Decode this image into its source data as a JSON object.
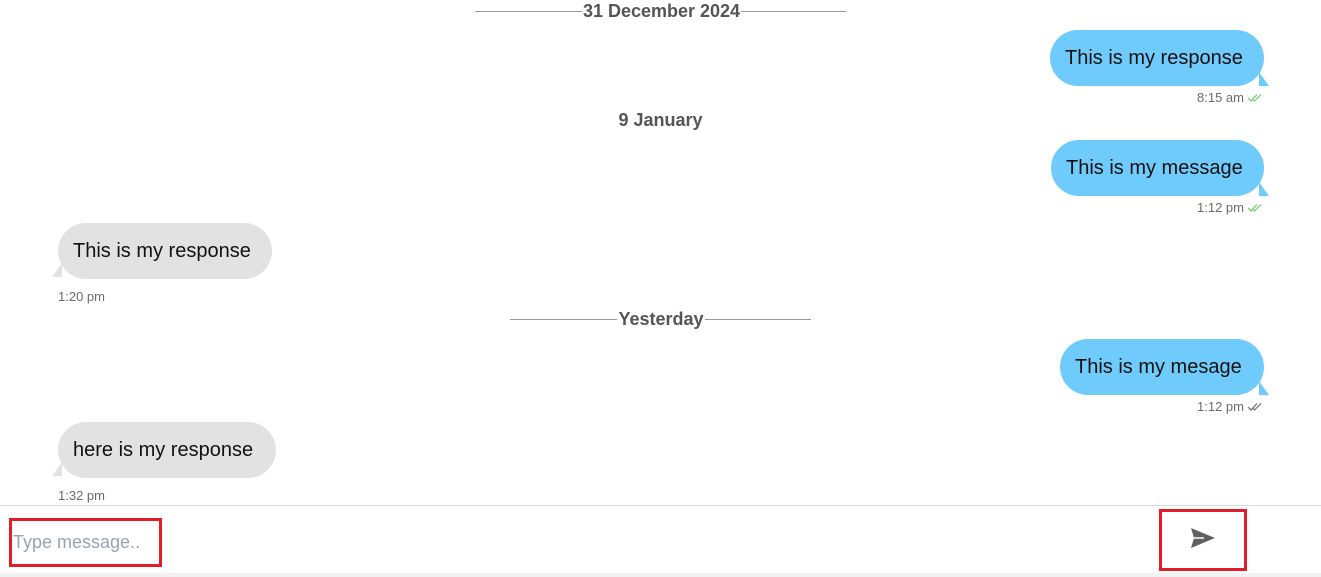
{
  "messages_area": {
    "separators": [
      {
        "label": "31 December 2024"
      },
      {
        "label": "9 January"
      },
      {
        "label": "Yesterday"
      }
    ],
    "messages": [
      {
        "direction": "outgoing",
        "text": "This is my response",
        "time": "8:15 am",
        "status": "read"
      },
      {
        "direction": "outgoing",
        "text": "This is my message",
        "time": "1:12 pm",
        "status": "read"
      },
      {
        "direction": "incoming",
        "text": "This is my response",
        "time": "1:20 pm"
      },
      {
        "direction": "outgoing",
        "text": "This is my mesage",
        "time": "1:12 pm",
        "status": "delivered"
      },
      {
        "direction": "incoming",
        "text": "here is my response",
        "time": "1:32 pm"
      }
    ]
  },
  "composer": {
    "placeholder": "Type message..",
    "value": "",
    "send_icon": "send-icon"
  },
  "colors": {
    "outgoing_bubble": "#6ecbfb",
    "incoming_bubble": "#e2e2e2",
    "read_tick": "#7ccf7c",
    "delivered_tick": "#7a7a7a",
    "highlight_border": "#e11d2a"
  }
}
